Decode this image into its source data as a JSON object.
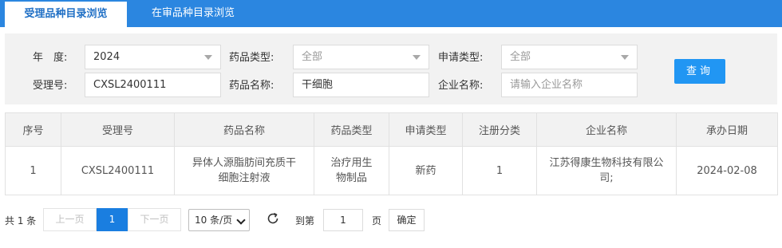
{
  "tabs": [
    {
      "label": "受理品种目录浏览",
      "active": true
    },
    {
      "label": "在审品种目录浏览",
      "active": false
    }
  ],
  "filters": {
    "year_label": "年　度:",
    "year_value": "2024",
    "drug_type_label": "药品类型:",
    "drug_type_value": "全部",
    "apply_type_label": "申请类型:",
    "apply_type_value": "全部",
    "accept_no_label": "受理号:",
    "accept_no_value": "CXSL2400111",
    "drug_name_label": "药品名称:",
    "drug_name_value": "干细胞",
    "company_label": "企业名称:",
    "company_placeholder": "请输入企业名称",
    "query_button": "查询"
  },
  "table": {
    "headers": [
      "序号",
      "受理号",
      "药品名称",
      "药品类型",
      "申请类型",
      "注册分类",
      "企业名称",
      "承办日期"
    ],
    "rows": [
      {
        "index": "1",
        "accept_no": "CXSL2400111",
        "drug_name": "异体人源脂肪间充质干细胞注射液",
        "drug_type": "治疗用生物制品",
        "apply_type": "新药",
        "reg_class": "1",
        "company": "江苏得康生物科技有限公司;",
        "date": "2024-02-08"
      }
    ]
  },
  "pagination": {
    "total": "共 1 条",
    "prev": "上一页",
    "current": "1",
    "next": "下一页",
    "page_size": "10 条/页",
    "goto_label": "到第",
    "goto_value": "1",
    "page_suffix": "页",
    "confirm": "确定"
  },
  "colors": {
    "tab_bar": "#2b86e0",
    "primary_button": "#2196f3",
    "active_page": "#1a7ee0"
  }
}
